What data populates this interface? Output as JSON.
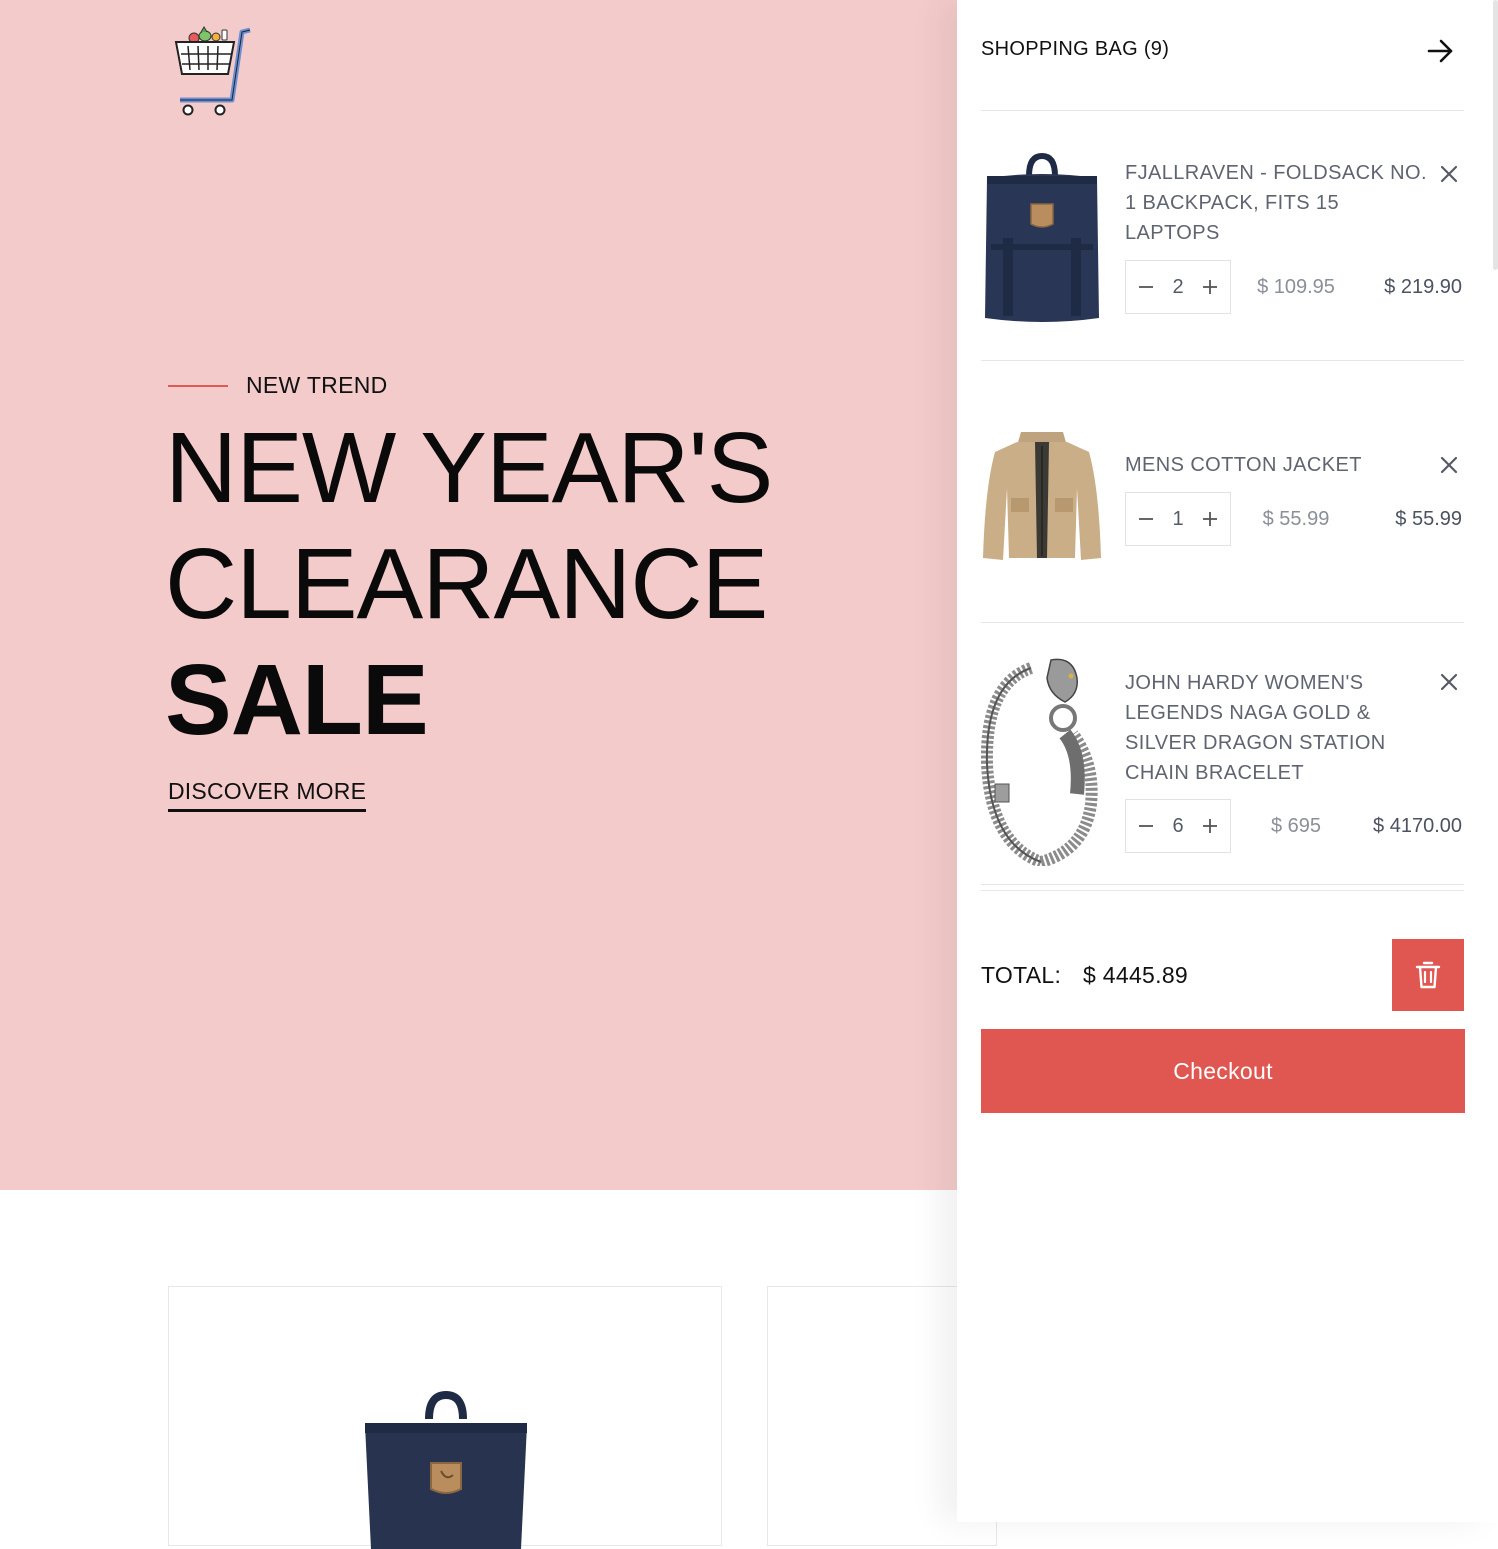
{
  "hero": {
    "eyebrow": "NEW TREND",
    "headline_line1": "NEW YEAR'S",
    "headline_line2": "CLEARANCE",
    "headline_line3": "SALE",
    "cta": "DISCOVER MORE",
    "background_color": "#f4cbcb",
    "accent_color": "#e05a54"
  },
  "cart": {
    "title": "SHOPPING BAG (9)",
    "items": [
      {
        "name": "FJALLRAVEN - FOLDSACK NO. 1 BACKPACK, FITS 15 LAPTOPS",
        "quantity": "2",
        "unit_price": "$ 109.95",
        "line_total": "$ 219.90",
        "image_icon": "backpack-image"
      },
      {
        "name": "MENS COTTON JACKET",
        "quantity": "1",
        "unit_price": "$ 55.99",
        "line_total": "$ 55.99",
        "image_icon": "jacket-image"
      },
      {
        "name": "JOHN HARDY WOMEN'S LEGENDS NAGA GOLD & SILVER DRAGON STATION CHAIN BRACELET",
        "quantity": "6",
        "unit_price": "$ 695",
        "line_total": "$ 4170.00",
        "image_icon": "bracelet-image"
      }
    ],
    "total_label": "TOTAL:",
    "total_value": "$ 4445.89",
    "checkout_label": "Checkout",
    "button_color": "#e05651"
  }
}
